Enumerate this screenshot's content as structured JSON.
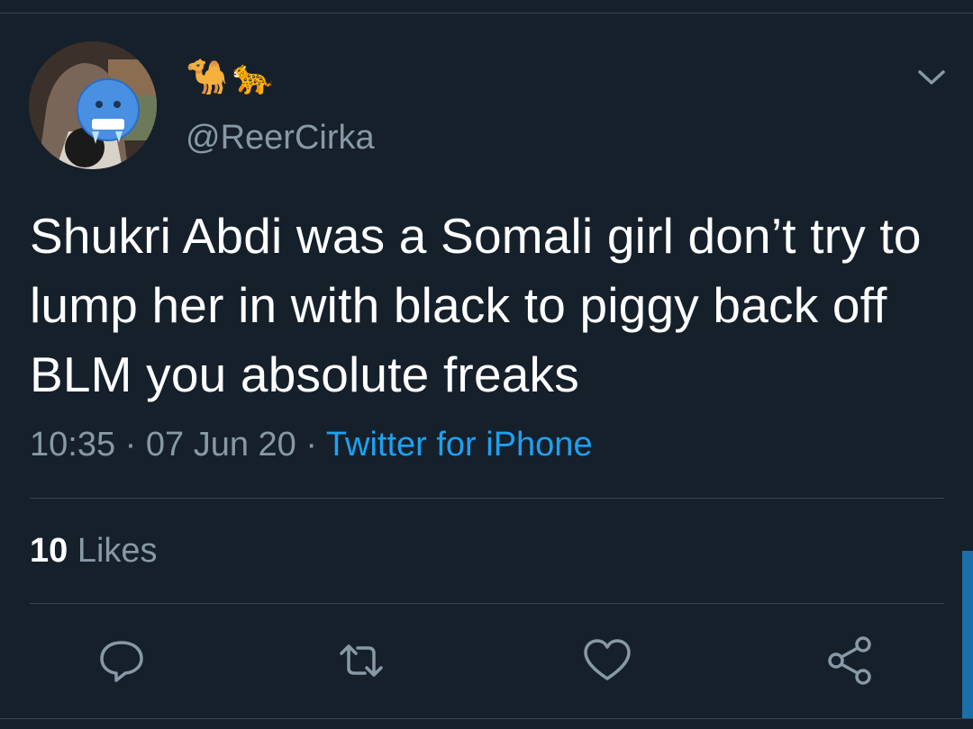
{
  "tweet": {
    "display_name": "🐪🐆",
    "handle": "@ReerCirka",
    "text": "Shukri Abdi was a Somali girl don’t try to lump her in with black to piggy back off BLM you absolute freaks",
    "time": "10:35",
    "date": "07 Jun 20",
    "separator": "·",
    "source": "Twitter for iPhone",
    "likes_count": "10",
    "likes_label": "Likes"
  },
  "colors": {
    "background": "#15202b",
    "secondary_text": "#8899a6",
    "link": "#1da1f2",
    "divider": "#38444d"
  },
  "icons": {
    "more": "chevron-down-icon",
    "reply": "reply-icon",
    "retweet": "retweet-icon",
    "like": "heart-icon",
    "share": "share-icon"
  }
}
